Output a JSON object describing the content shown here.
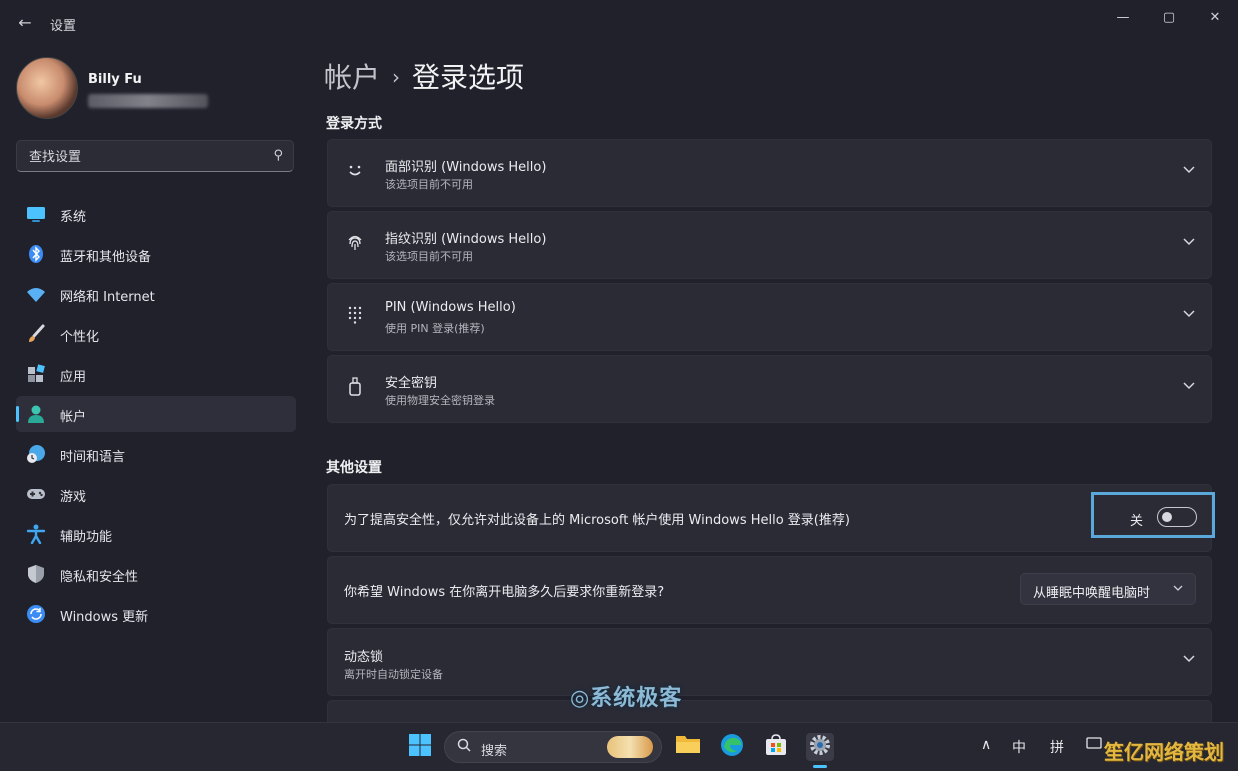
{
  "window": {
    "title": "设置",
    "back_label": "←",
    "minimize": "—",
    "maximize": "▢",
    "close": "✕"
  },
  "profile": {
    "name": "Billy Fu"
  },
  "search": {
    "placeholder": "查找设置"
  },
  "sidebar": {
    "items": [
      {
        "label": "系统",
        "icon": "monitor-icon",
        "color": "#4cc2ff"
      },
      {
        "label": "蓝牙和其他设备",
        "icon": "bluetooth-icon",
        "color": "#3b8df5"
      },
      {
        "label": "网络和 Internet",
        "icon": "wifi-icon",
        "color": "#5ab0f5"
      },
      {
        "label": "个性化",
        "icon": "brush-icon",
        "color": "#e8a35a"
      },
      {
        "label": "应用",
        "icon": "apps-icon",
        "color": "#b9c0cc"
      },
      {
        "label": "帐户",
        "icon": "person-icon",
        "color": "#3cc6b2",
        "active": true
      },
      {
        "label": "时间和语言",
        "icon": "globe-clock-icon",
        "color": "#4aa8e8"
      },
      {
        "label": "游戏",
        "icon": "gamepad-icon",
        "color": "#b9c0cc"
      },
      {
        "label": "辅助功能",
        "icon": "accessibility-icon",
        "color": "#3fa7f0"
      },
      {
        "label": "隐私和安全性",
        "icon": "shield-icon",
        "color": "#9aa0aa"
      },
      {
        "label": "Windows 更新",
        "icon": "update-icon",
        "color": "#3b8df5"
      }
    ]
  },
  "breadcrumb": {
    "parent": "帐户",
    "separator": "›",
    "current": "登录选项"
  },
  "signin": {
    "heading": "登录方式",
    "options": [
      {
        "title": "面部识别 (Windows Hello)",
        "subtitle": "该选项目前不可用",
        "icon": "face-icon"
      },
      {
        "title": "指纹识别 (Windows Hello)",
        "subtitle": "该选项目前不可用",
        "icon": "fingerprint-icon"
      },
      {
        "title": "PIN (Windows Hello)",
        "subtitle": "使用 PIN 登录(推荐)",
        "icon": "keypad-icon"
      },
      {
        "title": "安全密钥",
        "subtitle": "使用物理安全密钥登录",
        "icon": "usb-key-icon"
      }
    ]
  },
  "other": {
    "heading": "其他设置",
    "hello_only": {
      "label": "为了提高安全性，仅允许对此设备上的 Microsoft 帐户使用 Windows Hello 登录(推荐)",
      "state_label": "关",
      "value": false
    },
    "reauth": {
      "label": "你希望 Windows 在你离开电脑多久后要求你重新登录?",
      "selected": "从睡眠中唤醒电脑时"
    },
    "dynamic_lock": {
      "title": "动态锁",
      "subtitle": "离开时自动锁定设备"
    }
  },
  "watermark": {
    "text": "系统极客"
  },
  "taskbar": {
    "search_label": "搜索",
    "tray": {
      "chevron": "∧",
      "ime1": "中",
      "ime2": "拼"
    }
  },
  "corner_watermark": {
    "text": "笙亿网络策划"
  },
  "colors": {
    "accent": "#4cc2ff",
    "highlight_box": "#5aa9da"
  }
}
